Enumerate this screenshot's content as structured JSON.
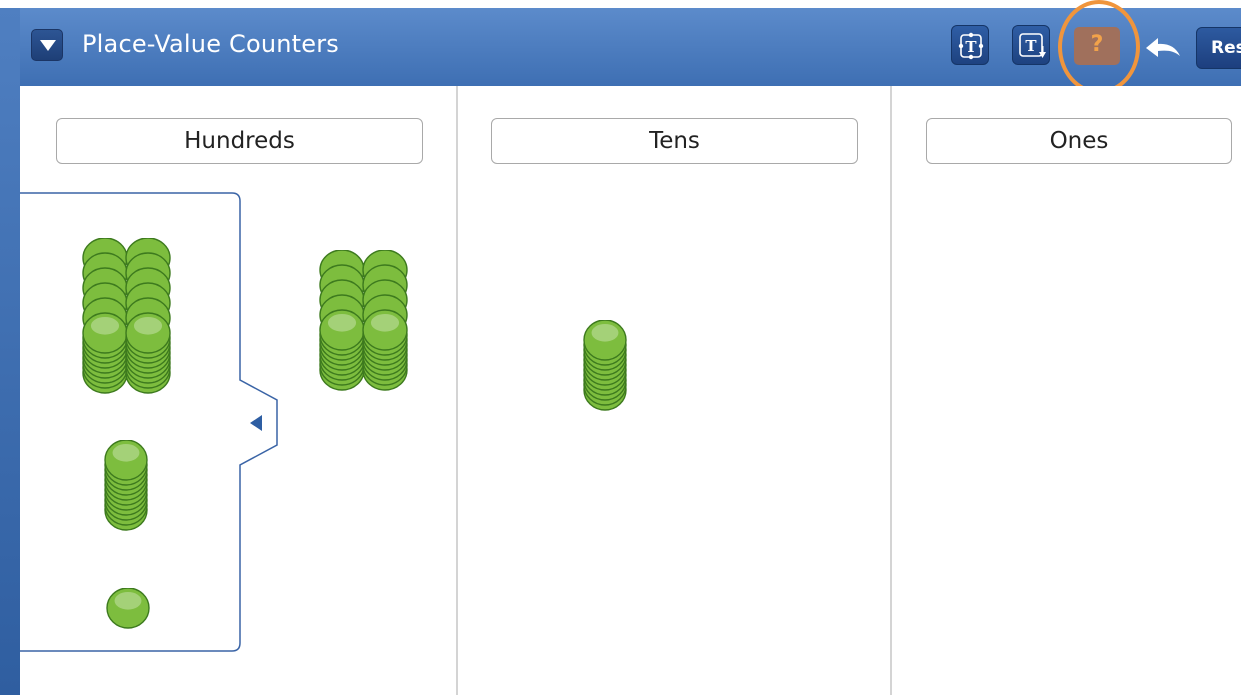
{
  "app": {
    "title": "Place-Value Counters"
  },
  "toolbar": {
    "menu_icon": "triangle-down-icon",
    "text_tool_icon": "text-box-icon",
    "text_size_icon": "text-size-icon",
    "help_label": "?",
    "undo_icon": "undo-arrow-icon",
    "reset_label": "Res"
  },
  "columns": [
    {
      "label": "Hundreds"
    },
    {
      "label": "Tens"
    },
    {
      "label": "Ones"
    }
  ],
  "tray": {
    "collapse_icon": "triangle-left-icon",
    "stacks": [
      {
        "name": "tray-stack-100a",
        "counters": 10
      },
      {
        "name": "tray-stack-100b",
        "counters": 10
      },
      {
        "name": "tray-stack-10",
        "counters": 10
      },
      {
        "name": "tray-counter-1",
        "counters": 1
      }
    ]
  },
  "board": {
    "hundreds_stack_counters": [
      10,
      10
    ],
    "tens_stack_counters": 10
  },
  "colors": {
    "header": "#4f80c2",
    "counter": "#7dbd3e",
    "counter_outline": "#3d7a1e",
    "help_highlight": "#f0953c",
    "help_button": "#a0705c"
  }
}
